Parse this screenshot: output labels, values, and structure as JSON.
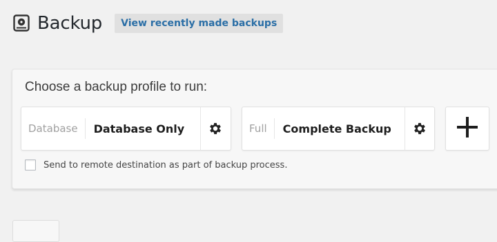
{
  "header": {
    "title": "Backup",
    "view_link": "View recently made backups",
    "icon": "backup-icon"
  },
  "panel": {
    "heading": "Choose a backup profile to run:",
    "profiles": [
      {
        "type": "Database",
        "name": "Database Only",
        "settings_icon": "gear-icon"
      },
      {
        "type": "Full",
        "name": "Complete Backup",
        "settings_icon": "gear-icon"
      }
    ],
    "add_icon": "plus-icon",
    "remote_checkbox": {
      "label": "Send to remote destination as part of backup process.",
      "checked": false
    }
  },
  "colors": {
    "link": "#2a6ea6",
    "background": "#f1f1f1",
    "panel": "#f7f7f7"
  }
}
